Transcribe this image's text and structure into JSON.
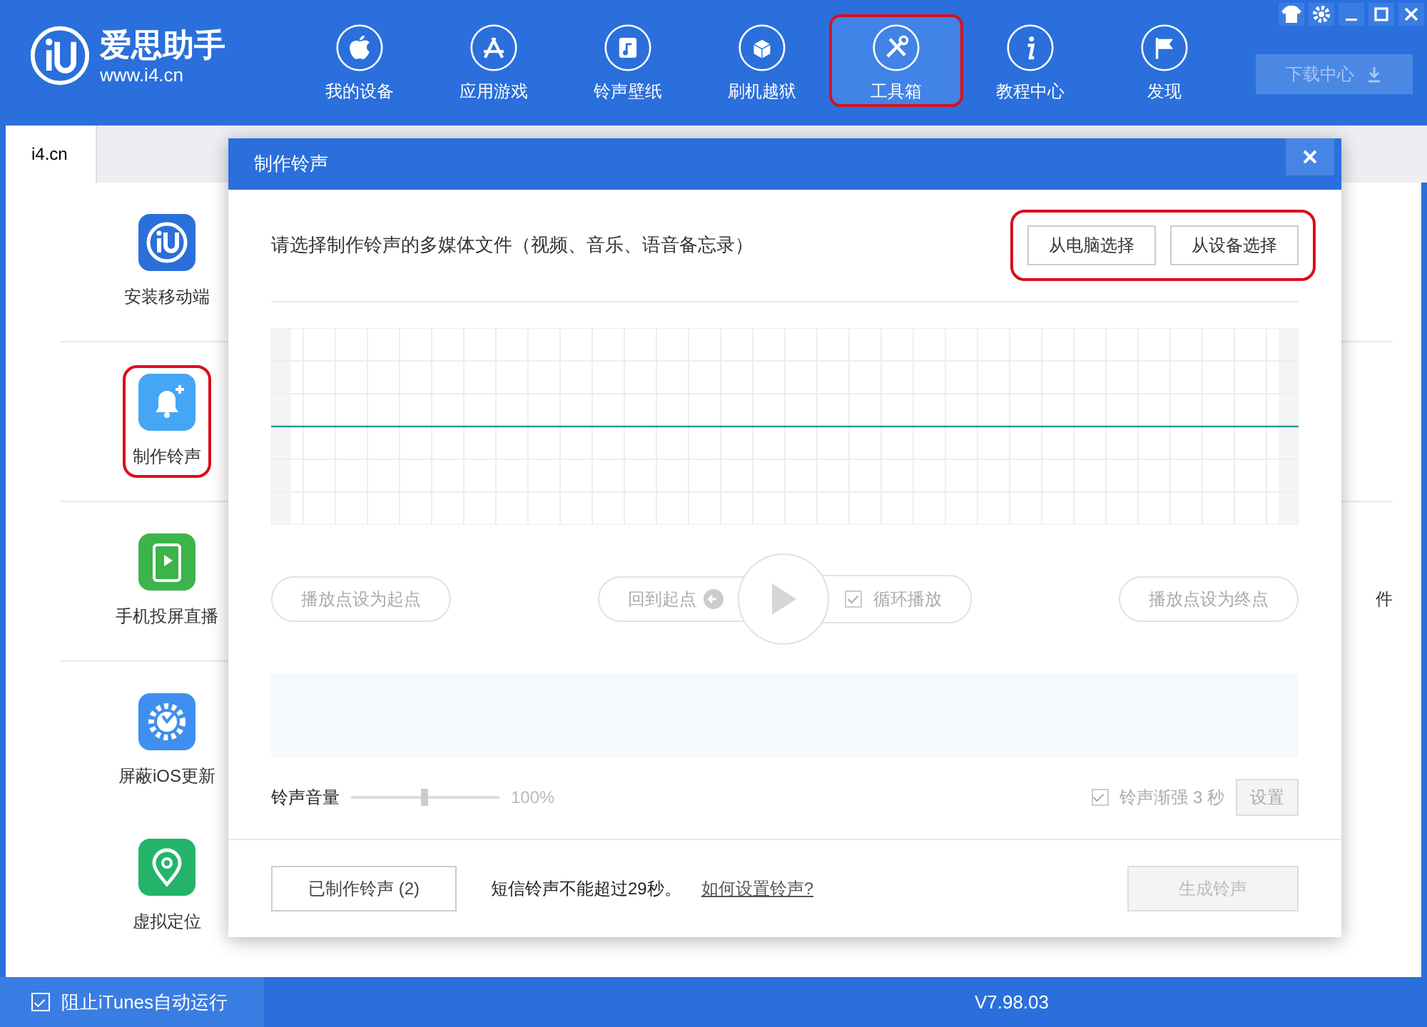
{
  "app": {
    "name": "爱思助手",
    "url": "www.i4.cn"
  },
  "nav": [
    {
      "label": "我的设备",
      "kind": "apple",
      "highlighted": false
    },
    {
      "label": "应用游戏",
      "kind": "appstore",
      "highlighted": false
    },
    {
      "label": "铃声壁纸",
      "kind": "music",
      "highlighted": false
    },
    {
      "label": "刷机越狱",
      "kind": "box",
      "highlighted": false
    },
    {
      "label": "工具箱",
      "kind": "tools",
      "highlighted": true
    },
    {
      "label": "教程中心",
      "kind": "info",
      "highlighted": false
    },
    {
      "label": "发现",
      "kind": "flag",
      "highlighted": false
    }
  ],
  "download_button": {
    "label": "下载中心",
    "disabled": true
  },
  "tabs": [
    {
      "label": "i4.cn",
      "selected": true
    }
  ],
  "tools": [
    {
      "label": "安装移动端",
      "kind": "logo",
      "color": "#2b6fd8",
      "highlighted": false
    },
    {
      "label": "制作铃声",
      "kind": "bell",
      "color": "#45a6f5",
      "highlighted": true
    },
    {
      "label": "手机投屏直播",
      "kind": "screen",
      "color": "#3cb44a",
      "highlighted": false
    },
    {
      "label": "屏蔽iOS更新",
      "kind": "gear",
      "color": "#3f8ff0",
      "highlighted": false
    },
    {
      "label": "虚拟定位",
      "kind": "location",
      "color": "#23b46a",
      "highlighted": false
    }
  ],
  "right_fragment": "件",
  "dialog": {
    "title": "制作铃声",
    "prompt": "请选择制作铃声的多媒体文件（视频、音乐、语音备忘录）",
    "source_buttons": [
      "从电脑选择",
      "从设备选择"
    ],
    "source_buttons_highlighted": true,
    "set_start": "播放点设为起点",
    "back_to_start": "回到起点",
    "loop": {
      "label": "循环播放",
      "checked": true
    },
    "set_end": "播放点设为终点",
    "volume": {
      "label": "铃声音量",
      "level": 0.5,
      "reading": "100%"
    },
    "fade": {
      "label": "铃声渐强 3 秒",
      "checked": true
    },
    "settings_button": "设置",
    "made_button": "已制作铃声 (2)",
    "note": "短信铃声不能超过29秒。",
    "help_link": "如何设置铃声?",
    "generate_button": "生成铃声"
  },
  "status_bar": {
    "itunes": {
      "label": "阻止iTunes自动运行",
      "checked": true
    },
    "version": "V7.98.03"
  }
}
